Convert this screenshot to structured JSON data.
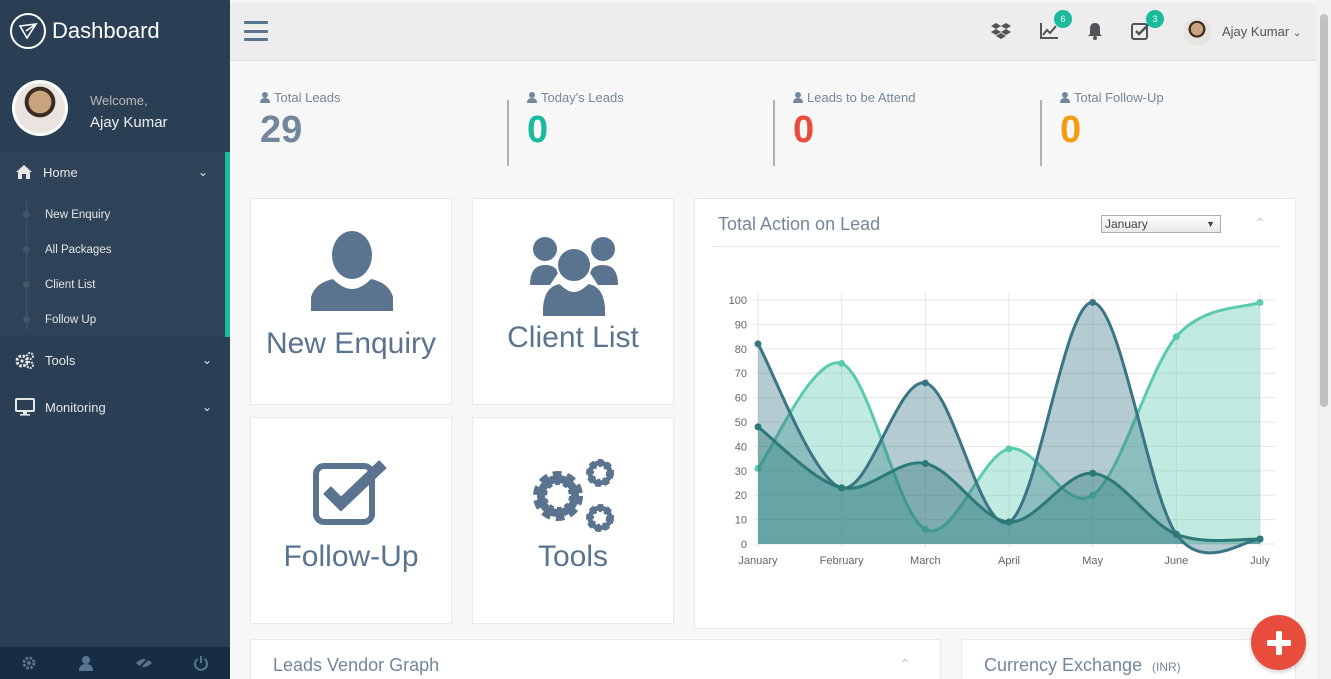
{
  "sidebar": {
    "brand_title": "Dashboard",
    "welcome": "Welcome,",
    "user_name": "Ajay Kumar",
    "menu": [
      {
        "label": "Home",
        "icon": "home-icon"
      },
      {
        "label": "Tools",
        "icon": "gears-icon"
      },
      {
        "label": "Monitoring",
        "icon": "desktop-icon"
      }
    ],
    "home_sub": [
      "New Enquiry",
      "All Packages",
      "Client List",
      "Follow Up"
    ],
    "footer_icons": [
      "settings-icon",
      "user-icon",
      "eye-slash-icon",
      "power-icon"
    ]
  },
  "topnav": {
    "user_name": "Ajay Kumar",
    "chart_badge": "6",
    "tasks_badge": "3"
  },
  "stats": [
    {
      "label": "Total Leads",
      "value": "29",
      "color": "#73879c"
    },
    {
      "label": "Today's Leads",
      "value": "0",
      "color": "#1abb9c"
    },
    {
      "label": "Leads to be Attend",
      "value": "0",
      "color": "#e74c3c"
    },
    {
      "label": "Total Follow-Up",
      "value": "0",
      "color": "#f39c12"
    }
  ],
  "tiles": {
    "new_enquiry": "New Enquiry",
    "client_list": "Client List",
    "follow_up": "Follow-Up",
    "tools": "Tools"
  },
  "lead_panel": {
    "title": "Total Action on Lead",
    "month_selected": "January"
  },
  "vendor_panel": {
    "title": "Leads Vendor Graph"
  },
  "currency_panel": {
    "title": "Currency Exchange",
    "unit": "(INR)"
  },
  "chart_data": {
    "type": "area",
    "categories": [
      "January",
      "February",
      "March",
      "April",
      "May",
      "June",
      "July"
    ],
    "ylim": [
      0,
      100
    ],
    "yticks": [
      0,
      10,
      20,
      30,
      40,
      50,
      60,
      70,
      80,
      90,
      100
    ],
    "grid": true,
    "series": [
      {
        "values": [
          31,
          74,
          6,
          39,
          20,
          85,
          99
        ],
        "color": "#5ccbad"
      },
      {
        "values": [
          82,
          23,
          66,
          9,
          99,
          4,
          2
        ],
        "color": "#3a7586"
      },
      {
        "values": [
          48,
          23,
          33,
          9,
          29,
          4,
          2
        ],
        "color": "#2b7a78"
      }
    ]
  }
}
